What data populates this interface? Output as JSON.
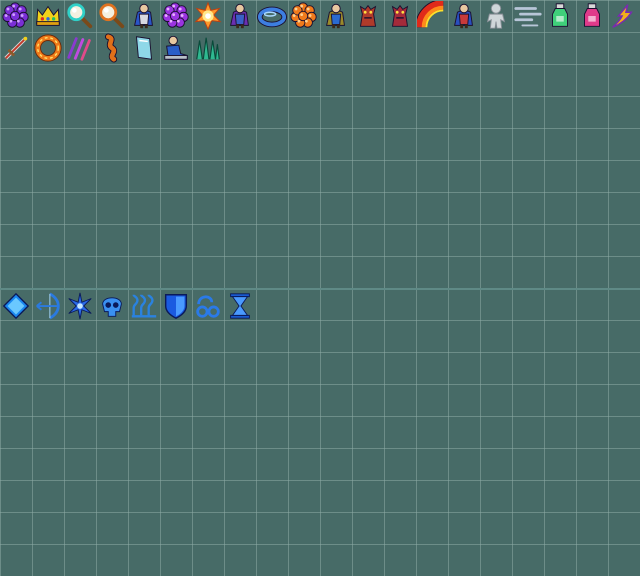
{
  "sheet": {
    "columns": 20,
    "rows": 18,
    "background_color": "#476b67",
    "grid_color": "#8caaa5"
  },
  "row_1": [
    {
      "name": "purple-orb-cluster-icon",
      "color": "#7a2fd6"
    },
    {
      "name": "gold-crown-icon",
      "color": "#f2d21a"
    },
    {
      "name": "cyan-magnifier-icon",
      "color": "#2fd1c8"
    },
    {
      "name": "orange-magnifier-icon",
      "color": "#e0721f"
    },
    {
      "name": "blue-caped-hero-icon",
      "color": "#2a55c8"
    },
    {
      "name": "purple-flower-icon",
      "color": "#9a34e0"
    },
    {
      "name": "fire-burst-icon",
      "color": "#ff9a2a"
    },
    {
      "name": "purple-caped-wizard-icon",
      "color": "#6b2fb0"
    },
    {
      "name": "blue-ring-icon",
      "color": "#3d7ee0"
    },
    {
      "name": "orange-orb-cluster-icon",
      "color": "#f07a1c"
    },
    {
      "name": "olive-caped-warrior-icon",
      "color": "#9a8a2a"
    },
    {
      "name": "red-creature-icon",
      "color": "#b03a2a"
    },
    {
      "name": "red-beast-icon",
      "color": "#a42a3a"
    },
    {
      "name": "rainbow-arc-icon",
      "color": "#e02a1a"
    },
    {
      "name": "blue-caped-knight-icon",
      "color": "#2a4fbf"
    },
    {
      "name": "grey-ghost-figure-icon",
      "color": "#cfd6d9"
    },
    {
      "name": "wind-streaks-icon",
      "color": "#b8c6d8"
    },
    {
      "name": "green-potion-icon",
      "color": "#3fd07a"
    },
    {
      "name": "pink-potion-icon",
      "color": "#e03a8a"
    },
    {
      "name": "lightning-bolt-icon",
      "color": "#f2b01a"
    }
  ],
  "row_2": [
    {
      "name": "red-dagger-icon",
      "color": "#c03a2a"
    },
    {
      "name": "fire-ring-icon",
      "color": "#f07a1a"
    },
    {
      "name": "claw-slash-icon",
      "color": "#8a3ad0"
    },
    {
      "name": "orange-worm-icon",
      "color": "#e0701a"
    },
    {
      "name": "cyan-card-icon",
      "color": "#8fd8e8"
    },
    {
      "name": "blue-seated-figure-icon",
      "color": "#2a5ec8"
    },
    {
      "name": "green-spikes-icon",
      "color": "#2fb890"
    }
  ],
  "row_10": [
    {
      "name": "blue-diamond-icon",
      "color": "#1a88f0"
    },
    {
      "name": "blue-bow-icon",
      "color": "#2a7ae0"
    },
    {
      "name": "blue-sparkle-icon",
      "color": "#2a6ae8"
    },
    {
      "name": "blue-skull-icon",
      "color": "#3a90f0"
    },
    {
      "name": "blue-heat-waves-icon",
      "color": "#2a82e0"
    },
    {
      "name": "blue-shield-icon",
      "color": "#1a5ae0"
    },
    {
      "name": "blue-shackles-icon",
      "color": "#2a7ae8"
    },
    {
      "name": "blue-hourglass-icon",
      "color": "#1a5ad0"
    }
  ]
}
